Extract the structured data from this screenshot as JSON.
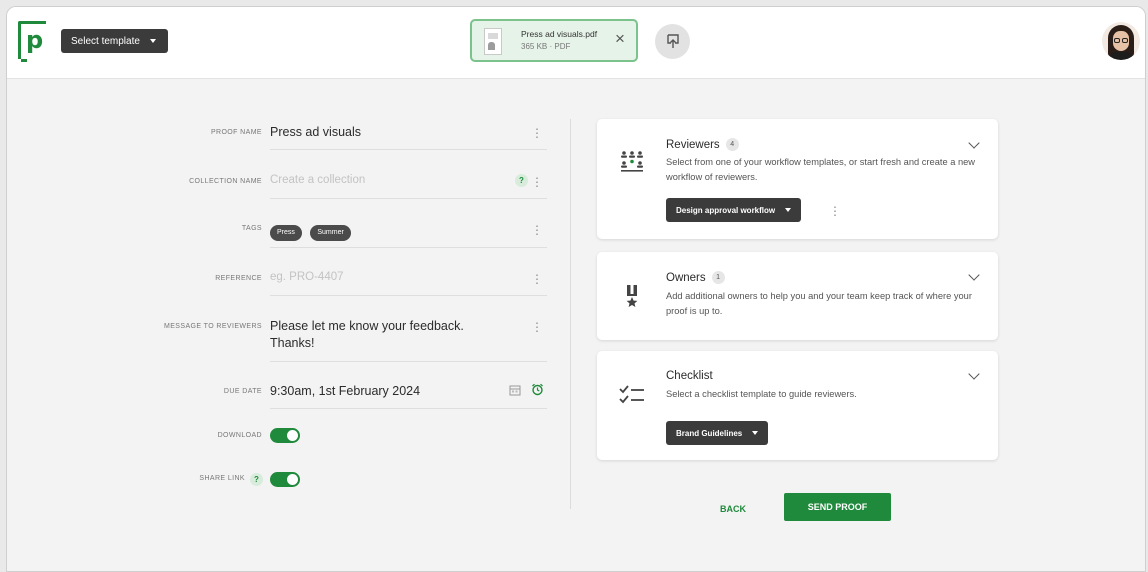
{
  "header": {
    "logo_letter": "p",
    "template_button": "Select template",
    "file": {
      "name": "Press ad visuals.pdf",
      "meta": "365 KB · PDF",
      "close": "×"
    }
  },
  "form": {
    "proof_name": {
      "label": "PROOF NAME",
      "value": "Press ad visuals"
    },
    "collection_name": {
      "label": "COLLECTION NAME",
      "placeholder": "Create a collection",
      "help": "?"
    },
    "tags": {
      "label": "TAGS",
      "items": [
        "Press",
        "Summer"
      ]
    },
    "reference": {
      "label": "REFERENCE",
      "placeholder": "eg. PRO-4407"
    },
    "message": {
      "label": "MESSAGE TO REVIEWERS",
      "line1": "Please let me know your feedback.",
      "line2": "Thanks!"
    },
    "due_date": {
      "label": "DUE DATE",
      "value": "9:30am, 1st February 2024"
    },
    "download": {
      "label": "DOWNLOAD",
      "enabled": true
    },
    "share_link": {
      "label": "SHARE LINK",
      "help": "?",
      "enabled": true
    }
  },
  "cards": {
    "reviewers": {
      "title": "Reviewers",
      "count": "4",
      "desc": "Select from one of your workflow templates, or start fresh and create a new workflow of reviewers.",
      "button": "Design approval workflow"
    },
    "owners": {
      "title": "Owners",
      "count": "1",
      "desc": "Add additional owners to help you and your team keep track of where your proof is up to."
    },
    "checklist": {
      "title": "Checklist",
      "desc": "Select a checklist template to guide reviewers.",
      "button": "Brand Guidelines"
    }
  },
  "actions": {
    "back": "BACK",
    "send": "SEND PROOF"
  },
  "colors": {
    "brand_green": "#1f8a3b",
    "dark_button": "#3b3b3b",
    "chip_bg": "#e6f3e9"
  },
  "icons": [
    "logo-icon",
    "caret-down-icon",
    "pdf-thumbnail-icon",
    "close-icon",
    "upload-icon",
    "more-vertical-icon",
    "help-icon",
    "calendar-icon",
    "alarm-clock-icon",
    "reviewers-icon",
    "award-icon",
    "checklist-icon",
    "chevron-down-icon"
  ]
}
